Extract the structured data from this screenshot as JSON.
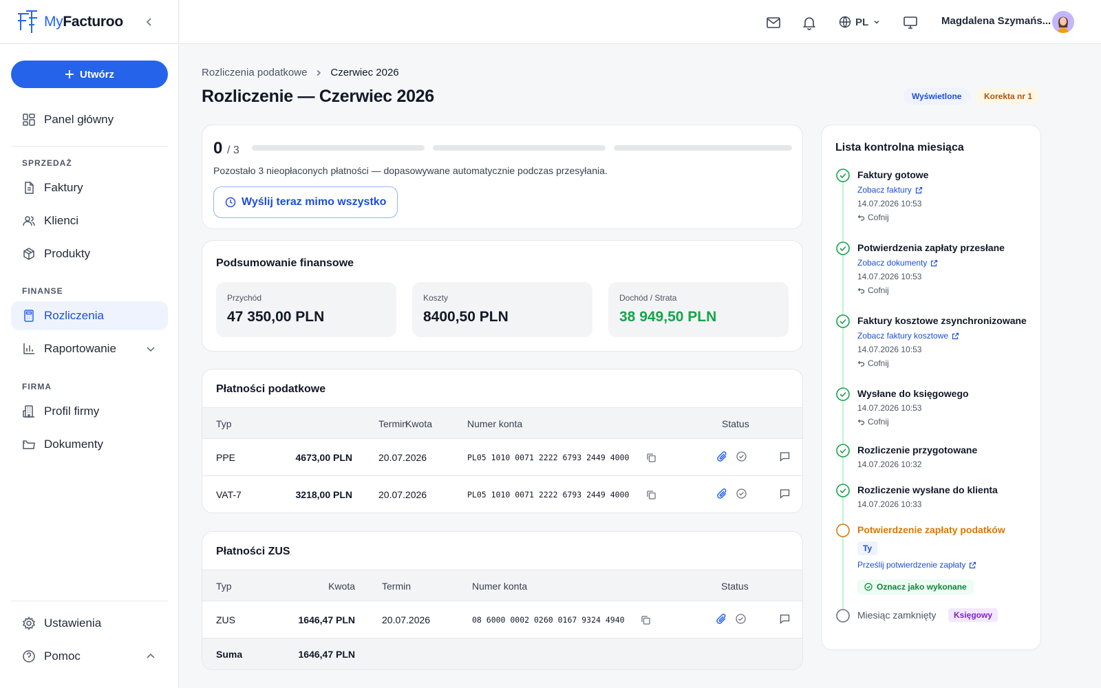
{
  "brand": {
    "name_pre": "My",
    "name_main": "Facturoo"
  },
  "sidebar": {
    "create_label": "Utwórz",
    "dashboard": "Panel główny",
    "sections": {
      "sales": "SPRZEDAŻ",
      "finance": "FINANSE",
      "company": "FIRMA"
    },
    "items": {
      "invoices": "Faktury",
      "clients": "Klienci",
      "products": "Produkty",
      "settlements": "Rozliczenia",
      "reporting": "Raportowanie",
      "company_profile": "Profil firmy",
      "documents": "Dokumenty",
      "settings": "Ustawienia",
      "help": "Pomoc"
    }
  },
  "topbar": {
    "language": "PL",
    "user_name": "Magdalena Szymańs..."
  },
  "breadcrumb": {
    "parent": "Rozliczenia podatkowe",
    "current": "Czerwiec 2026"
  },
  "page": {
    "title": "Rozliczenie — Czerwiec 2026",
    "badges": {
      "viewed": "Wyświetlone",
      "correction": "Korekta nr 1"
    }
  },
  "progress": {
    "done": "0",
    "total": "/ 3",
    "segments": [
      0,
      0,
      0
    ],
    "note": "Pozostało 3 nieopłaconych płatności — dopasowywane automatycznie podczas przesyłania.",
    "send_label": "Wyślij teraz mimo wszystko"
  },
  "finance": {
    "title": "Podsumowanie finansowe",
    "revenue_label": "Przychód",
    "revenue": "47 350,00 PLN",
    "costs_label": "Koszty",
    "costs": "8400,50 PLN",
    "income_label": "Dochód / Strata",
    "income": "38 949,50 PLN"
  },
  "tax_payments": {
    "title": "Płatności podatkowe",
    "headers": {
      "type": "Typ",
      "amount": "Kwota",
      "due": "Termin",
      "account": "Numer konta",
      "status": "Status"
    },
    "rows": [
      {
        "type": "PPE",
        "amount": "4673,00 PLN",
        "due": "20.07.2026",
        "account": "PL05 1010 0071 2222 6793 2449 4000"
      },
      {
        "type": "VAT-7",
        "amount": "3218,00 PLN",
        "due": "20.07.2026",
        "account": "PL05 1010 0071 2222 6793 2449 4000"
      }
    ]
  },
  "zus_payments": {
    "title": "Płatności ZUS",
    "headers": {
      "type": "Typ",
      "amount": "Kwota",
      "due": "Termin",
      "account": "Numer konta",
      "status": "Status"
    },
    "rows": [
      {
        "type": "ZUS",
        "amount": "1646,47 PLN",
        "due": "20.07.2026",
        "account": "08 6000 0002 0260 0167 9324 4940"
      }
    ],
    "sum_label": "Suma",
    "sum_value": "1646,47 PLN"
  },
  "checklist": {
    "title": "Lista kontrolna miesiąca",
    "undo_label": "Cofnij",
    "steps": [
      {
        "title": "Faktury gotowe",
        "link": "Zobacz faktury",
        "date": "14.07.2026 10:53"
      },
      {
        "title": "Potwierdzenia zapłaty przesłane",
        "link": "Zobacz dokumenty",
        "date": "14.07.2026 10:53"
      },
      {
        "title": "Faktury kosztowe zsynchronizowane",
        "link": "Zobacz faktury kosztowe",
        "date": "14.07.2026 10:53"
      },
      {
        "title": "Wysłane do księgowego",
        "date": "14.07.2026 10:53"
      },
      {
        "title": "Rozliczenie przygotowane",
        "date": "14.07.2026 10:32"
      },
      {
        "title": "Rozliczenie wysłane do klienta",
        "date": "14.07.2026 10:33"
      },
      {
        "title": "Potwierdzenie zapłaty podatków",
        "tag": "Ty",
        "link": "Prześlij potwierdzenie zapłaty",
        "action": "Oznacz jako wykonane"
      },
      {
        "title": "Miesiąc zamknięty",
        "tag": "Księgowy"
      }
    ]
  },
  "colors": {
    "accent": "#2563eb",
    "success": "#16a34a",
    "warning": "#d97706",
    "purple": "#7e22ce"
  }
}
